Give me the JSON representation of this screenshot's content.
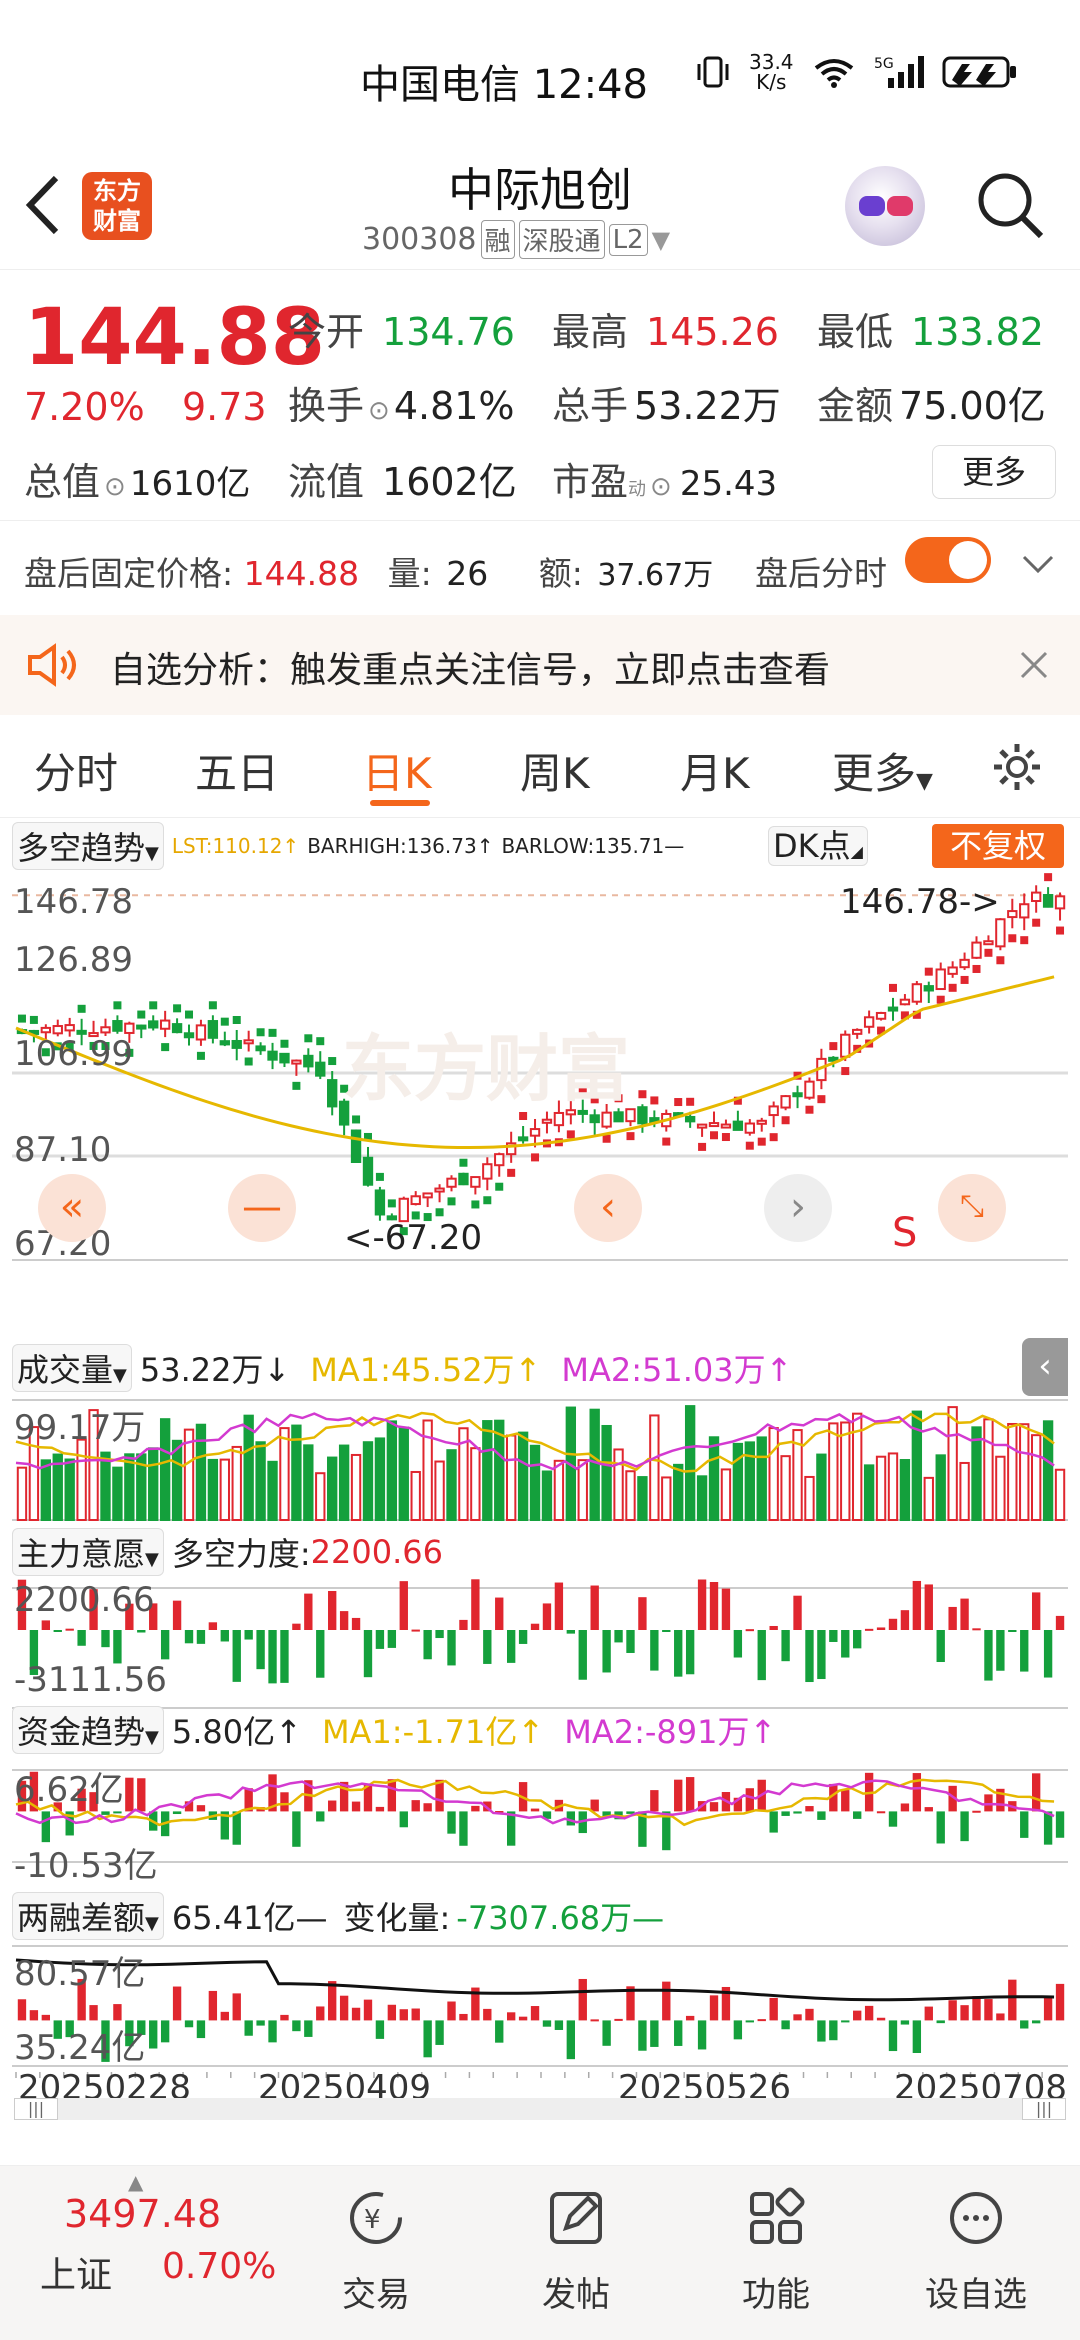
{
  "status": {
    "carrier_time": "中国电信 12:48",
    "net_speed_value": "33.4",
    "net_speed_unit": "K/s",
    "signal": "5G"
  },
  "header": {
    "logo_text": "东方财富",
    "name": "中际旭创",
    "code": "300308",
    "tags": [
      "融",
      "深股通",
      "L2"
    ]
  },
  "quote": {
    "price": "144.88",
    "pct": "7.20%",
    "change": "9.73",
    "open_label": "今开",
    "open": "134.76",
    "high_label": "最高",
    "high": "145.26",
    "low_label": "最低",
    "low": "133.82",
    "turnover_label": "换手",
    "turnover": "4.81%",
    "volume_label": "总手",
    "volume": "53.22万",
    "amount_label": "金额",
    "amount": "75.00亿",
    "mktcap_label": "总值",
    "mktcap": "1610亿",
    "float_label": "流值",
    "float": "1602亿",
    "pe_label": "市盈",
    "pe_sup": "动",
    "pe": "25.43",
    "more": "更多"
  },
  "after_hours": {
    "price_label": "盘后固定价格:",
    "price": "144.88",
    "vol_label": "量:",
    "vol": "26",
    "amt_label": "额:",
    "amt": "37.67万",
    "toggle_label": "盘后分时"
  },
  "alert": {
    "text": "自选分析：触发重点关注信号，立即点击查看"
  },
  "tabs": [
    "分时",
    "五日",
    "日K",
    "周K",
    "月K",
    "更多"
  ],
  "kline": {
    "indicator": "多空趋势",
    "lst": "LST:110.12↑",
    "barhigh": "BARHIGH:136.73↑",
    "barlow": "BARLOW:135.71—",
    "dk_btn": "DK点",
    "adjust_btn": "不复权",
    "y_labels": [
      "146.78",
      "126.89",
      "106.99",
      "87.10",
      "67.20"
    ],
    "high_mark": "146.78->",
    "low_mark": "<-67.20",
    "watermark": "东方财富",
    "s_mark": "S"
  },
  "volume_panel": {
    "selector": "成交量",
    "value": "53.22万↓",
    "ma1": "MA1:45.52万↑",
    "ma2": "MA2:51.03万↑",
    "y_top": "99.17万"
  },
  "force_panel": {
    "selector": "主力意愿",
    "label": "多空力度:",
    "value": "2200.66",
    "y_top": "2200.66",
    "y_bottom": "-3111.56"
  },
  "fund_panel": {
    "selector": "资金趋势",
    "value": "5.80亿↑",
    "ma1": "MA1:-1.71亿↑",
    "ma2": "MA2:-891万↑",
    "y_top": "6.62亿",
    "y_bottom": "-10.53亿"
  },
  "margin_panel": {
    "selector": "两融差额",
    "value": "65.41亿—",
    "change_label": "变化量:",
    "change": "-7307.68万—",
    "y_top": "80.57亿",
    "y_bottom": "35.24亿"
  },
  "dates": [
    "20250228",
    "20250409",
    "20250526",
    "20250708"
  ],
  "bottom": {
    "index_value": "3497.48",
    "index_name": "上证",
    "index_pct": "0.70%",
    "items": [
      "交易",
      "发帖",
      "功能",
      "设自选"
    ]
  }
}
